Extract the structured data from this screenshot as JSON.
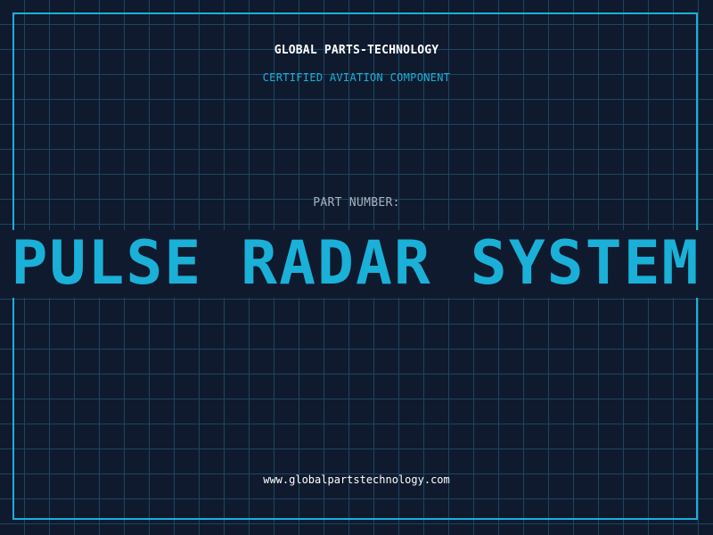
{
  "header": {
    "company_name": "GLOBAL PARTS-TECHNOLOGY",
    "subtitle": "CERTIFIED AVIATION COMPONENT"
  },
  "main": {
    "part_number_label": "PART NUMBER:",
    "part_name": "PULSE RADAR SYSTEM"
  },
  "footer": {
    "website": "www.globalpartstechnology.com"
  },
  "colors": {
    "background": "#101a2e",
    "grid": "#1d4560",
    "accent": "#1ab0d8",
    "text_primary": "#ffffff",
    "text_muted": "#a7b3c1"
  }
}
